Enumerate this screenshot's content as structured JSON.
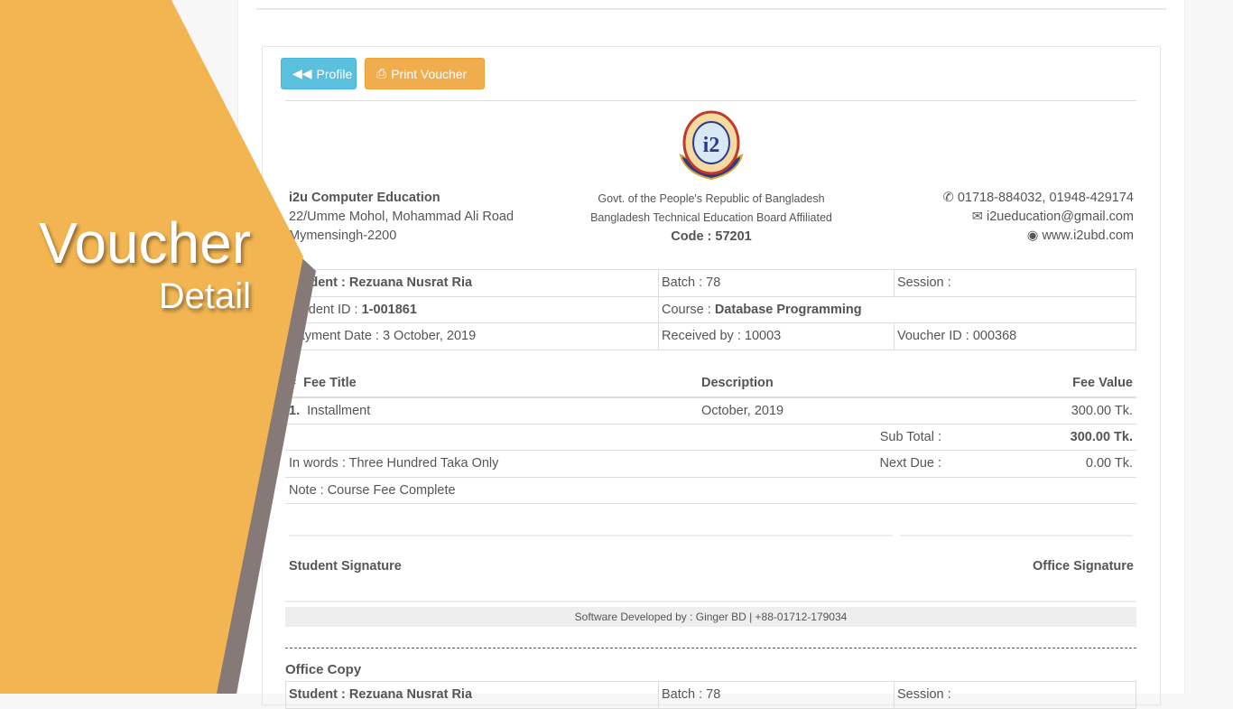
{
  "overlay": {
    "title": "Voucher",
    "subtitle": "Detail",
    "colors": {
      "orange": "#f2b552",
      "gray": "#857a78"
    }
  },
  "toolbar": {
    "profile_label": "Profile",
    "print_label": "Print Voucher",
    "profile_color": "#5bc0de",
    "print_color": "#f0ad4e"
  },
  "header": {
    "org_name": "i2u Computer Education",
    "address1": "22/Umme Mohol, Mohammad Ali Road",
    "address2": "Mymensingh-2200",
    "govt": "Govt. of the People's Republic of Bangladesh",
    "board": "Bangladesh Technical Education Board Affiliated",
    "code": "Code : 57201",
    "phone": "01718-884032, 01948-429174",
    "email": "i2ueducation@gmail.com",
    "website": "www.i2ubd.com"
  },
  "info": {
    "student_label": "Student : ",
    "student": "Rezuana Nusrat Ria",
    "batch": "Batch : 78",
    "session": "Session :",
    "id_label": "Student ID : ",
    "id": "1-001861",
    "course_label": "Course : ",
    "course": "Database Programming",
    "payment_date": "Payment Date : 3 October, 2019",
    "received_by": "Received by : 10003",
    "voucher_id": "Voucher ID : 000368"
  },
  "fees": {
    "headers": [
      "#",
      "Fee Title",
      "Description",
      "Fee Value"
    ],
    "rows": [
      {
        "no": "1.",
        "title": "Installment",
        "description": "October, 2019",
        "value": "300.00 Tk."
      }
    ],
    "subtotal_label": "Sub Total :",
    "subtotal": "300.00 Tk.",
    "in_words": "In words : Three Hundred Taka Only",
    "next_due_label": "Next Due :",
    "next_due": "0.00 Tk.",
    "note": "Note : Course Fee Complete"
  },
  "signatures": {
    "student": "Student Signature",
    "office": "Office Signature"
  },
  "footer": {
    "developer": "Software Developed by : Ginger BD | +88-01712-179034"
  },
  "office_copy": {
    "title": "Office Copy",
    "student": "Student : Rezuana Nusrat Ria",
    "batch": "Batch : 78",
    "session": "Session :"
  }
}
